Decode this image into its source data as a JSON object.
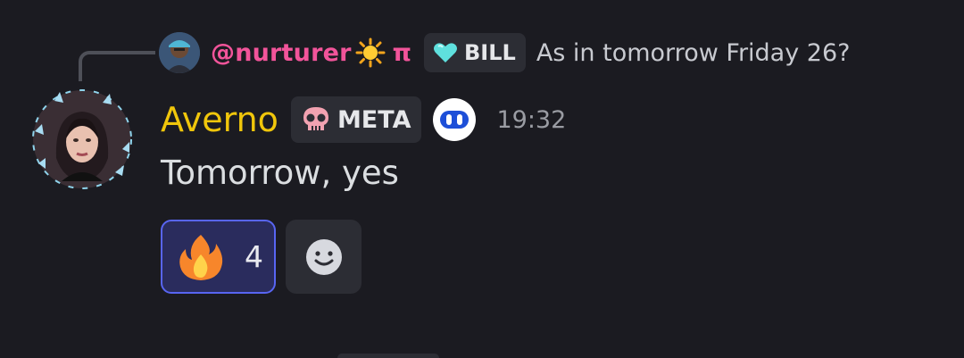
{
  "reply": {
    "username": "@nurturer",
    "name_suffix": "π",
    "tag_label": "BILL",
    "text": "As in tomorrow Friday 26?",
    "avatar_icon": "person-avatar-icon",
    "emoji_icon": "sun-icon",
    "tag_icon": "heart-icon"
  },
  "message": {
    "author": "Averno",
    "tag_label": "META",
    "tag_icon": "skull-icon",
    "bot_icon": "bot-face-icon",
    "timestamp": "19:32",
    "text": "Tomorrow, yes"
  },
  "reactions": [
    {
      "emoji_icon": "fire-icon",
      "count": "4",
      "selected": true
    }
  ],
  "add_reaction_icon": "smile-icon",
  "colors": {
    "background": "#1b1b21",
    "reply_name": "#f2549a",
    "author_name": "#f0c60b",
    "reaction_border": "#5865f2"
  }
}
